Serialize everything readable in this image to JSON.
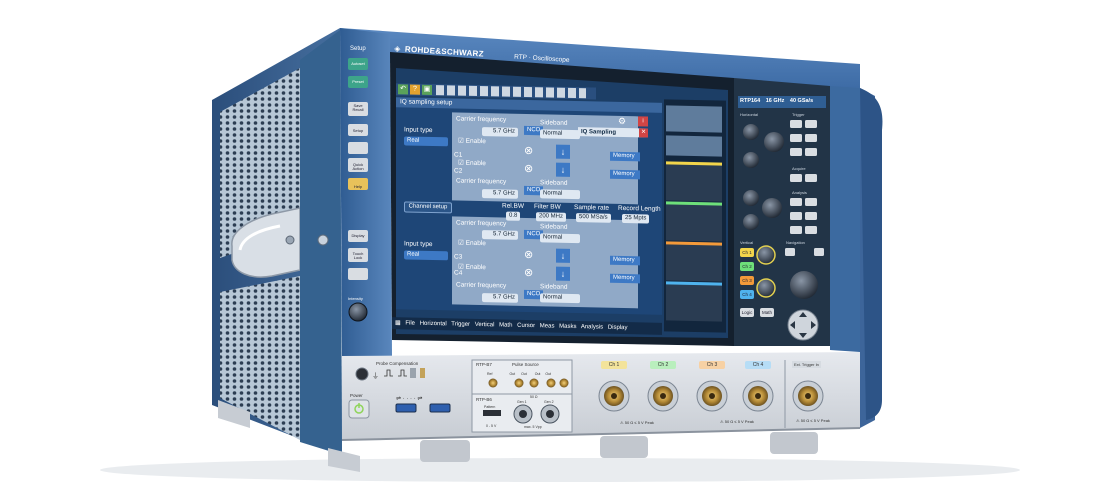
{
  "brand": {
    "logo_text": "ROHDE&SCHWARZ",
    "model": "RTP · Oscilloscope"
  },
  "left_panel": {
    "title": "Setup",
    "buttons": [
      "Autoset",
      "Preset",
      "Save Recall",
      "Setup",
      "Quick Action",
      "Help"
    ],
    "lower_buttons": [
      "Display",
      "Touch Lock"
    ],
    "knob_label": "Intensity"
  },
  "screen": {
    "dialog_title": "IQ sampling setup",
    "subpanel_title": "IQ Sampling",
    "carrier_frequency_label": "Carrier frequency",
    "carrier_values": [
      "5.7 GHz",
      "5.7 GHz",
      "5.7 GHz",
      "5.7 GHz"
    ],
    "enable_label": "Enable",
    "input_type_label": "Input type",
    "input_type_value": "Real",
    "channel_labels": [
      "C1",
      "C2",
      "C3",
      "C4"
    ],
    "nco_label": "NCO",
    "sideband_label": "Sideband",
    "sideband_value": "Normal",
    "memory_label": "Memory",
    "channel_setup_button": "Channel setup",
    "rel_bw_label": "Rel.BW",
    "rel_bw_value": "0.8",
    "filter_bw_label": "Filter BW",
    "filter_bw_value": "200 MHz",
    "sample_rate_label": "Sample rate",
    "sample_rate_value": "500 MSa/s",
    "record_length_label": "Record Length",
    "record_length_value": "25 Mpts",
    "menu": [
      "File",
      "Horizontal",
      "Trigger",
      "Vertical",
      "Math",
      "Cursor",
      "Meas",
      "Masks",
      "Analysis",
      "Display"
    ]
  },
  "right_panel": {
    "header_model": "RTP164",
    "header_bw": "16 GHz",
    "header_sr": "40 GSa/s",
    "sections": [
      "Horizontal",
      "Trigger",
      "Acquire",
      "Analysis",
      "Vertical",
      "Navigation"
    ],
    "channel_buttons": [
      "Ch 1",
      "Ch 2",
      "Ch 3",
      "Ch 4"
    ],
    "logic_button": "Logic",
    "math_button": "Math"
  },
  "front": {
    "power_label": "Power",
    "probe_comp_label": "Probe Compensation",
    "rtp_b7_label": "RTP-B7",
    "pulse_source_label": "Pulse Source",
    "pulse_ports": [
      "Ref",
      "Out",
      "Out",
      "Out",
      "Out"
    ],
    "rtp_b6_label": "RTP-B6",
    "gen_labels": [
      "Gen 1",
      "Gen 2"
    ],
    "pattern_label": "Pattern",
    "pattern_range": "0 - 5 V",
    "gen_spec": "max. 5 Vpp",
    "channel_tags": [
      "Ch 1",
      "Ch 2",
      "Ch 3",
      "Ch 4"
    ],
    "ext_trigger_label": "Ext. Trigger In",
    "spec_left": "50 Ω ≤ 5 V Peak",
    "spec_right": "50 Ω ≤ 5 V Peak",
    "spec_ext": "50 Ω ≤ 5 V Peak",
    "gen_ohm": "50 Ω"
  },
  "colors": {
    "chassis_blue": "#3e6aa0",
    "screen_bg": "#1c3e66",
    "ch1": "#f2d54b",
    "ch2": "#6ee07a",
    "ch3": "#f39a3a",
    "ch4": "#4fb3ee",
    "power_led": "#8fd45a"
  }
}
